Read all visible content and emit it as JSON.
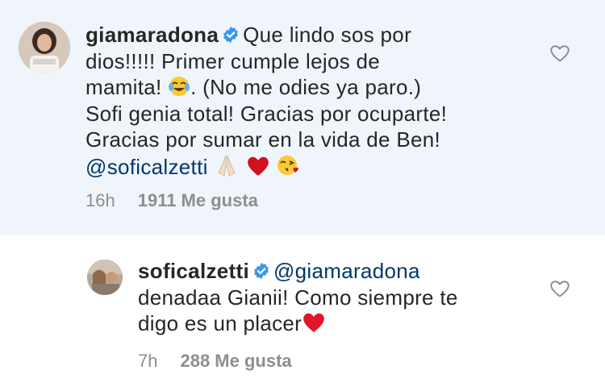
{
  "comments": [
    {
      "username": "giamaradona",
      "text_lines": [
        "Que lindo sos por",
        "dios!!!!! Primer cumple lejos de",
        "mamita!",
        ". (No me odies ya paro.)",
        "Sofi genia total! Gracias por ocuparte!",
        "Gracias por sumar en la vida de Ben!"
      ],
      "mention": "@soficalzetti",
      "time": "16h",
      "likes": "1911 Me gusta"
    },
    {
      "username": "soficalzetti",
      "mention": "@giamaradona",
      "text_lines": [
        "denadaa Gianii! Como siempre te",
        "digo es un placer"
      ],
      "time": "7h",
      "likes": "288 Me gusta"
    }
  ],
  "icons": {
    "verified": "verified-badge-icon",
    "like": "heart-outline-icon",
    "emoji_laugh": "tears-of-joy-emoji",
    "emoji_pray": "folded-hands-emoji",
    "emoji_heart": "red-heart-emoji",
    "emoji_kiss": "face-blowing-kiss-emoji"
  },
  "colors": {
    "highlight_bg": "#eff5fb",
    "verified_blue": "#3897f0",
    "mention_blue": "#00376b",
    "meta_gray": "#8e8e8e",
    "heart_red": "#e0162b"
  }
}
